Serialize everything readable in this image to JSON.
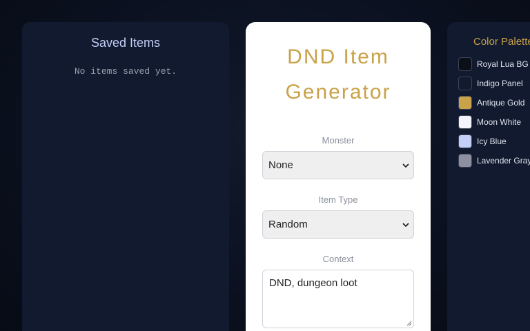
{
  "saved_panel": {
    "title": "Saved Items",
    "empty_message": "No items saved yet."
  },
  "main_panel": {
    "title": "DND Item Generator",
    "monster": {
      "label": "Monster",
      "selected": "None"
    },
    "item_type": {
      "label": "Item Type",
      "selected": "Random"
    },
    "context": {
      "label": "Context",
      "value": "DND, dungeon loot"
    },
    "accent_color": "#c9a24a"
  },
  "palette_panel": {
    "title": "Color Palette",
    "colors": [
      {
        "name": "Royal Lua BG",
        "hex": "#0b0f17"
      },
      {
        "name": "Indigo Panel",
        "hex": "#111a2e"
      },
      {
        "name": "Antique Gold",
        "hex": "#c9a24a"
      },
      {
        "name": "Moon White",
        "hex": "#f3f3fb"
      },
      {
        "name": "Icy Blue",
        "hex": "#c4cff8"
      },
      {
        "name": "Lavender Gray",
        "hex": "#8e90a0"
      }
    ]
  }
}
